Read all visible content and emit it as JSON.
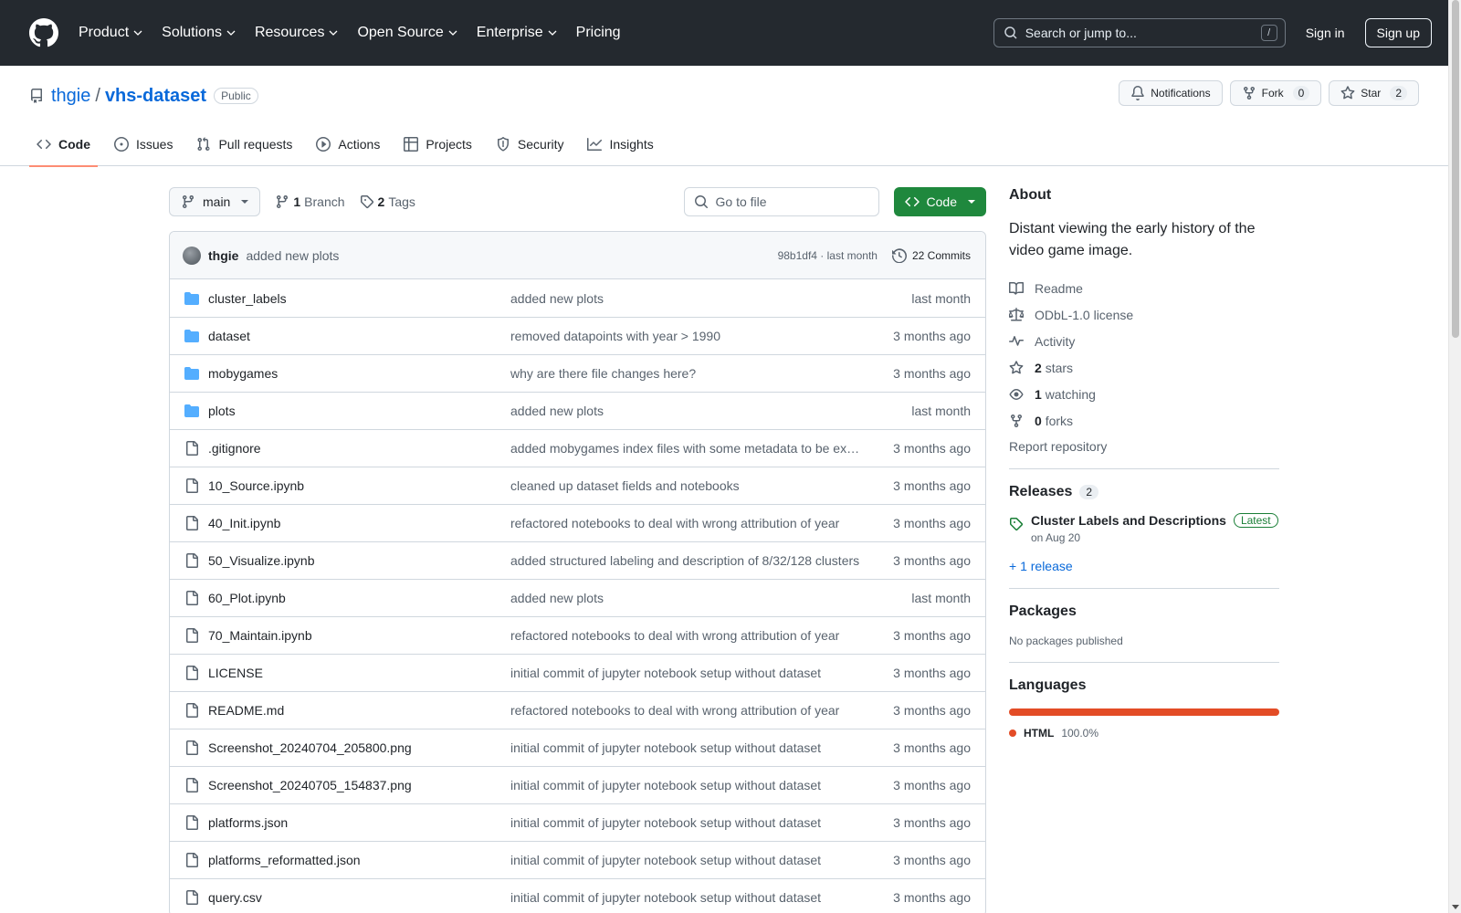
{
  "header": {
    "nav": [
      "Product",
      "Solutions",
      "Resources",
      "Open Source",
      "Enterprise",
      "Pricing"
    ],
    "search_placeholder": "Search or jump to...",
    "search_shortcut": "/",
    "sign_in": "Sign in",
    "sign_up": "Sign up"
  },
  "repo": {
    "owner": "thgie",
    "separator": "/",
    "name": "vhs-dataset",
    "visibility": "Public",
    "notifications_label": "Notifications",
    "fork_label": "Fork",
    "fork_count": "0",
    "star_label": "Star",
    "star_count": "2"
  },
  "tabs": [
    "Code",
    "Issues",
    "Pull requests",
    "Actions",
    "Projects",
    "Security",
    "Insights"
  ],
  "toolbar": {
    "branch": "main",
    "branch_count": "1",
    "branch_label": "Branch",
    "tag_count": "2",
    "tag_label": "Tags",
    "goto_placeholder": "Go to file",
    "code_button": "Code"
  },
  "latest_commit": {
    "author": "thgie",
    "message": "added new plots",
    "hash_time": "98b1df4 · last month",
    "commits": "22 Commits"
  },
  "files": [
    {
      "name": "cluster_labels",
      "type": "folder",
      "message": "added new plots",
      "time": "last month"
    },
    {
      "name": "dataset",
      "type": "folder",
      "message": "removed datapoints with year > 1990",
      "time": "3 months ago"
    },
    {
      "name": "mobygames",
      "type": "folder",
      "message": "why are there file changes here?",
      "time": "3 months ago"
    },
    {
      "name": "plots",
      "type": "folder",
      "message": "added new plots",
      "time": "last month"
    },
    {
      "name": ".gitignore",
      "type": "file",
      "message": "added mobygames index files with some metadata to be ex…",
      "time": "3 months ago"
    },
    {
      "name": "10_Source.ipynb",
      "type": "file",
      "message": "cleaned up dataset fields and notebooks",
      "time": "3 months ago"
    },
    {
      "name": "40_Init.ipynb",
      "type": "file",
      "message": "refactored notebooks to deal with wrong attribution of year",
      "time": "3 months ago"
    },
    {
      "name": "50_Visualize.ipynb",
      "type": "file",
      "message": "added structured labeling and description of 8/32/128 clusters",
      "time": "3 months ago"
    },
    {
      "name": "60_Plot.ipynb",
      "type": "file",
      "message": "added new plots",
      "time": "last month"
    },
    {
      "name": "70_Maintain.ipynb",
      "type": "file",
      "message": "refactored notebooks to deal with wrong attribution of year",
      "time": "3 months ago"
    },
    {
      "name": "LICENSE",
      "type": "file",
      "message": "initial commit of jupyter notebook setup without dataset",
      "time": "3 months ago"
    },
    {
      "name": "README.md",
      "type": "file",
      "message": "refactored notebooks to deal with wrong attribution of year",
      "time": "3 months ago"
    },
    {
      "name": "Screenshot_20240704_205800.png",
      "type": "file",
      "message": "initial commit of jupyter notebook setup without dataset",
      "time": "3 months ago"
    },
    {
      "name": "Screenshot_20240705_154837.png",
      "type": "file",
      "message": "initial commit of jupyter notebook setup without dataset",
      "time": "3 months ago"
    },
    {
      "name": "platforms.json",
      "type": "file",
      "message": "initial commit of jupyter notebook setup without dataset",
      "time": "3 months ago"
    },
    {
      "name": "platforms_reformatted.json",
      "type": "file",
      "message": "initial commit of jupyter notebook setup without dataset",
      "time": "3 months ago"
    },
    {
      "name": "query.csv",
      "type": "file",
      "message": "initial commit of jupyter notebook setup without dataset",
      "time": "3 months ago"
    }
  ],
  "about": {
    "title": "About",
    "description": "Distant viewing the early history of the video game image.",
    "readme": "Readme",
    "license": "ODbL-1.0 license",
    "activity": "Activity",
    "stars_count": "2",
    "stars_label": "stars",
    "watching_count": "1",
    "watching_label": "watching",
    "forks_count": "0",
    "forks_label": "forks",
    "report": "Report repository"
  },
  "releases": {
    "title": "Releases",
    "count": "2",
    "latest_title": "Cluster Labels and Descriptions",
    "latest_badge": "Latest",
    "latest_date": "on Aug 20",
    "more": "+ 1 release"
  },
  "packages": {
    "title": "Packages",
    "empty": "No packages published"
  },
  "languages": {
    "title": "Languages",
    "items": [
      {
        "name": "HTML",
        "percent": "100.0%",
        "color": "#e34c26"
      }
    ]
  },
  "colors": {
    "header_bg": "#24292f",
    "link": "#0969da",
    "code_button": "#1f883d",
    "folder": "#54aeff",
    "tab_underline": "#fd8c73"
  }
}
